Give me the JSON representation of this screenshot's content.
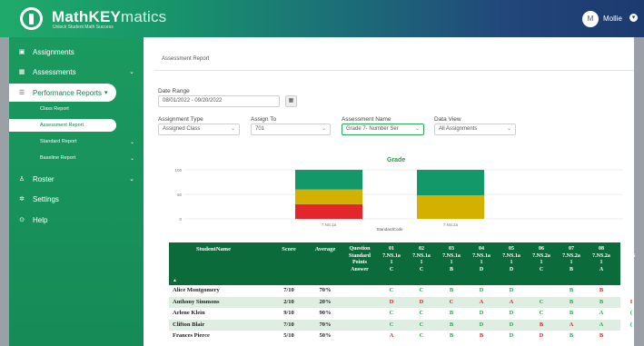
{
  "header": {
    "brand_bold": "MathKEY",
    "brand_light": "matics",
    "tagline": "Unlock Student Math Success",
    "avatar_initial": "M",
    "user_name": "Mollie",
    "colors": {
      "header_start": "#1faa6a",
      "header_end": "#1c3a6e"
    }
  },
  "sidebar": {
    "items": [
      {
        "label": "Assignments",
        "icon": "clipboard-icon"
      },
      {
        "label": "Assessments",
        "icon": "grid-icon"
      },
      {
        "label": "Performance Reports",
        "icon": "list-icon"
      },
      {
        "label": "Roster",
        "icon": "person-icon"
      },
      {
        "label": "Settings",
        "icon": "gear-icon"
      },
      {
        "label": "Help",
        "icon": "help-icon"
      }
    ],
    "sub_items": [
      {
        "label": "Class Report"
      },
      {
        "label": "Assessment Report"
      },
      {
        "label": "Standard Report"
      },
      {
        "label": "Baseline Report"
      }
    ]
  },
  "main": {
    "page_title": "Assessment Report",
    "date_range_label": "Date Range",
    "date_range_value": "08/01/2022 - 09/20/2022",
    "assignment_type_label": "Assignment Type",
    "assignment_type_value": "Assigned Class",
    "assign_to_label": "Assign To",
    "assign_to_value": "701",
    "assessment_name_label": "Assessment Name",
    "assessment_name_value": "Grade 7- Number Ser",
    "data_view_label": "Data View",
    "data_view_value": "All Assignments"
  },
  "chart_data": {
    "type": "bar",
    "title": "Grade",
    "xlabel": "StandardCode",
    "ylabel": "",
    "y_ticks": [
      "100",
      "50",
      "0"
    ],
    "ylim": [
      0,
      100
    ],
    "stacked": true,
    "categories": [
      "7.NS.1a",
      "7.NS.2a"
    ],
    "series": [
      {
        "color": "#e3262e",
        "values": [
          30,
          0
        ]
      },
      {
        "color": "#d4b000",
        "values": [
          30,
          48
        ]
      },
      {
        "color": "#13986a",
        "values": [
          40,
          52
        ]
      }
    ]
  },
  "table": {
    "headers": {
      "name": "StudentName",
      "score": "Score",
      "average": "Average"
    },
    "question_label": [
      "Question",
      "Standard",
      "Points",
      "Answer"
    ],
    "questions": [
      {
        "num": "01",
        "std1": "7.NS.1a",
        "pts": "1",
        "ans": "C"
      },
      {
        "num": "02",
        "std1": "7.NS.1a",
        "pts": "1",
        "ans": "C"
      },
      {
        "num": "03",
        "std1": "7.NS.1a",
        "pts": "1",
        "ans": "B"
      },
      {
        "num": "04",
        "std1": "7.NS.1a",
        "pts": "1",
        "ans": "D"
      },
      {
        "num": "05",
        "std1": "7.NS.1a",
        "pts": "1",
        "ans": "D"
      },
      {
        "num": "06",
        "std1": "7.NS.2a",
        "pts": "1",
        "ans": "C"
      },
      {
        "num": "07",
        "std1": "7.NS.2a",
        "pts": "1",
        "ans": "B"
      },
      {
        "num": "08",
        "std1": "7.NS.2a",
        "pts": "1",
        "ans": "A"
      },
      {
        "num": "0",
        "std1": "7.N",
        "pts": "",
        "ans": ""
      }
    ],
    "rows": [
      {
        "name": "Alice Montgomery",
        "score": "7/10",
        "avg": "70%",
        "answers": [
          "C",
          "C",
          "B",
          "D",
          "D",
          "",
          "B",
          "B",
          ""
        ],
        "correct": [
          1,
          1,
          1,
          1,
          1,
          1,
          1,
          0,
          1
        ]
      },
      {
        "name": "Anthony Simmons",
        "score": "2/10",
        "avg": "20%",
        "answers": [
          "D",
          "D",
          "C",
          "A",
          "A",
          "C",
          "B",
          "B",
          "I"
        ],
        "correct": [
          0,
          0,
          0,
          0,
          0,
          1,
          1,
          1,
          0
        ]
      },
      {
        "name": "Arlene Klein",
        "score": "9/10",
        "avg": "90%",
        "answers": [
          "C",
          "C",
          "B",
          "D",
          "D",
          "C",
          "B",
          "A",
          "("
        ],
        "correct": [
          1,
          1,
          1,
          1,
          1,
          1,
          1,
          1,
          1
        ]
      },
      {
        "name": "Clifton Blair",
        "score": "7/10",
        "avg": "70%",
        "answers": [
          "C",
          "C",
          "B",
          "D",
          "D",
          "B",
          "A",
          "A",
          "("
        ],
        "correct": [
          1,
          1,
          1,
          1,
          1,
          0,
          0,
          1,
          1
        ]
      },
      {
        "name": "Frances Pierce",
        "score": "5/10",
        "avg": "50%",
        "answers": [
          "A",
          "C",
          "B",
          "B",
          "D",
          "D",
          "B",
          "B",
          ""
        ],
        "correct": [
          0,
          1,
          1,
          0,
          1,
          0,
          1,
          0,
          1
        ]
      }
    ],
    "colors": {
      "correct": "#2aa84a",
      "wrong": "#e02424",
      "header": "#0b6b3a",
      "alt_row": "#dfeee3"
    }
  }
}
